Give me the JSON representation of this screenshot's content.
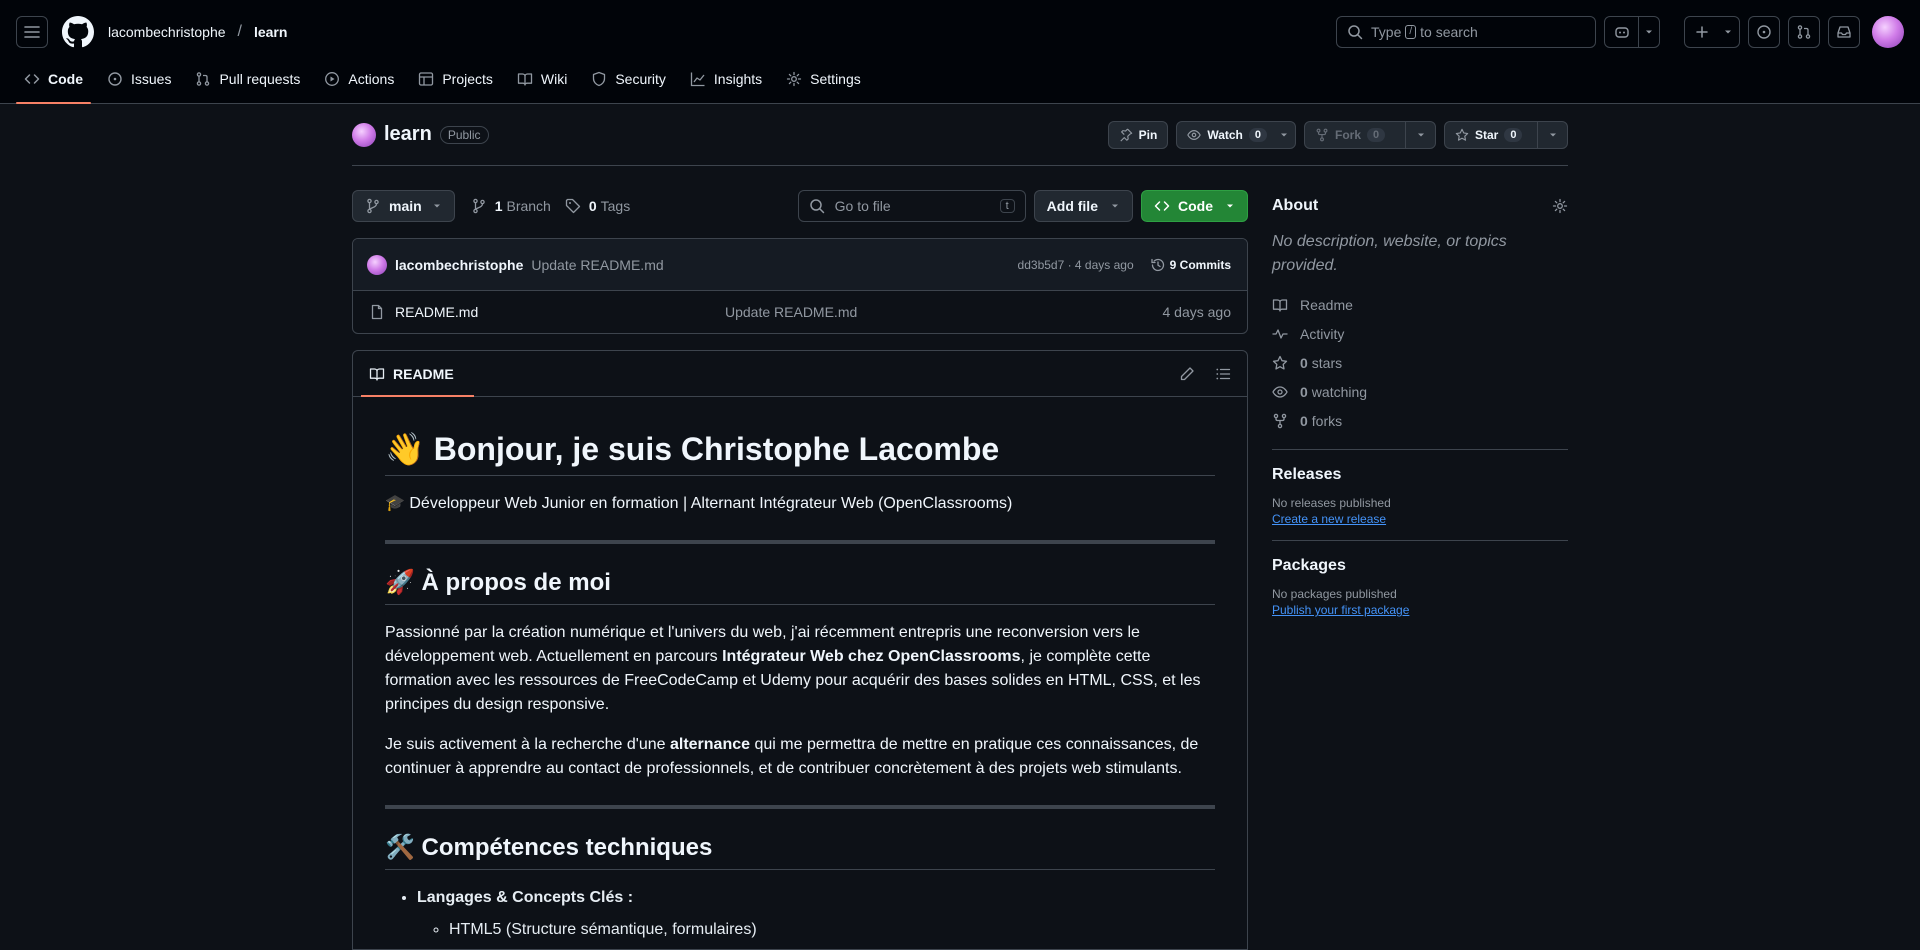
{
  "header": {
    "owner": "lacombechristophe",
    "separator": "/",
    "repo": "learn",
    "search_label": "Type",
    "search_kbd": "/",
    "search_suffix": "to search"
  },
  "tabs": [
    {
      "label": "Code",
      "icon": "code-icon"
    },
    {
      "label": "Issues",
      "icon": "issue-opened-icon"
    },
    {
      "label": "Pull requests",
      "icon": "git-pull-request-icon"
    },
    {
      "label": "Actions",
      "icon": "play-icon"
    },
    {
      "label": "Projects",
      "icon": "table-icon"
    },
    {
      "label": "Wiki",
      "icon": "book-icon"
    },
    {
      "label": "Security",
      "icon": "shield-icon"
    },
    {
      "label": "Insights",
      "icon": "graph-icon"
    },
    {
      "label": "Settings",
      "icon": "gear-icon"
    }
  ],
  "repo": {
    "name": "learn",
    "visibility": "Public",
    "pin_label": "Pin",
    "watch_label": "Watch",
    "watch_count": "0",
    "fork_label": "Fork",
    "fork_count": "0",
    "star_label": "Star",
    "star_count": "0"
  },
  "toolbar": {
    "branch": "main",
    "branch_count": "1",
    "branch_label": "Branch",
    "tag_count": "0",
    "tag_label": "Tags",
    "goto_placeholder": "Go to file",
    "goto_kbd": "t",
    "add_file": "Add file",
    "code": "Code"
  },
  "commit": {
    "author": "lacombechristophe",
    "message": "Update README.md",
    "meta": "dd3b5d7 · 4 days ago",
    "count_label": "9 Commits"
  },
  "files": [
    {
      "name": "README.md",
      "message": "Update README.md",
      "date": "4 days ago"
    }
  ],
  "readme": {
    "tab_label": "README",
    "h1": "👋 Bonjour, je suis Christophe Lacombe",
    "subtitle": "🎓 Développeur Web Junior en formation | Alternant Intégrateur Web (OpenClassrooms)",
    "h2_about": "🚀 À propos de moi",
    "p1_a": "Passionné par la création numérique et l'univers du web, j'ai récemment entrepris une reconversion vers le développement web. Actuellement en parcours ",
    "p1_b": "Intégrateur Web chez OpenClassrooms",
    "p1_c": ", je complète cette formation avec les ressources de FreeCodeCamp et Udemy pour acquérir des bases solides en HTML, CSS, et les principes du design responsive.",
    "p2_a": "Je suis activement à la recherche d'une ",
    "p2_b": "alternance",
    "p2_c": " qui me permettra de mettre en pratique ces connaissances, de continuer à apprendre au contact de professionnels, et de contribuer concrètement à des projets web stimulants.",
    "h2_skills": "🛠️ Compétences techniques",
    "li1": "Langages & Concepts Clés :",
    "li1_sub": "HTML5 (Structure sémantique, formulaires)"
  },
  "about": {
    "title": "About",
    "description": "No description, website, or topics provided.",
    "readme": "Readme",
    "activity": "Activity",
    "stars_count": "0",
    "stars_label": "stars",
    "watching_count": "0",
    "watching_label": "watching",
    "forks_count": "0",
    "forks_label": "forks"
  },
  "releases": {
    "title": "Releases",
    "empty": "No releases published",
    "link": "Create a new release"
  },
  "packages": {
    "title": "Packages",
    "empty": "No packages published",
    "link": "Publish your first package"
  },
  "colors": {
    "background": "#0d1117",
    "accent_underline": "#f78166",
    "primary_button": "#238636",
    "link": "#4493f8"
  }
}
